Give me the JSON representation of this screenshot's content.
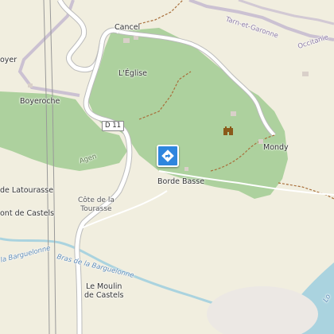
{
  "map": {
    "places": {
      "cancel": "Cancel",
      "leglise": "L'Église",
      "boyer": "oyer",
      "boyeroche": "Boyeroche",
      "mondy": "Mondy",
      "latourasse": "de Latourasse",
      "pont_castels": "ont de Castels",
      "cote_tourasse": "Côte de la\nTourasse",
      "borde_basse": "Borde Basse",
      "moulin_castels": "Le Moulin\nde Castels"
    },
    "road_shield": "D 11",
    "road_name": "Agen",
    "admin": {
      "tarn": "Tarn-et-Garonne",
      "occitanie": "Occitanie"
    },
    "waterways": {
      "barguelonne": "la Barguelonne",
      "bras": "Bras de la Barguelonne",
      "edge": "Lo"
    },
    "marker_icon": "directions-icon",
    "poi_icon": "castle-icon",
    "colors": {
      "background": "#f1eedf",
      "forest": "#add19e",
      "water": "#aad3df",
      "road": "#ffffff",
      "admin_boundary": "#b3a4c9",
      "marker": "#2e86de"
    }
  }
}
